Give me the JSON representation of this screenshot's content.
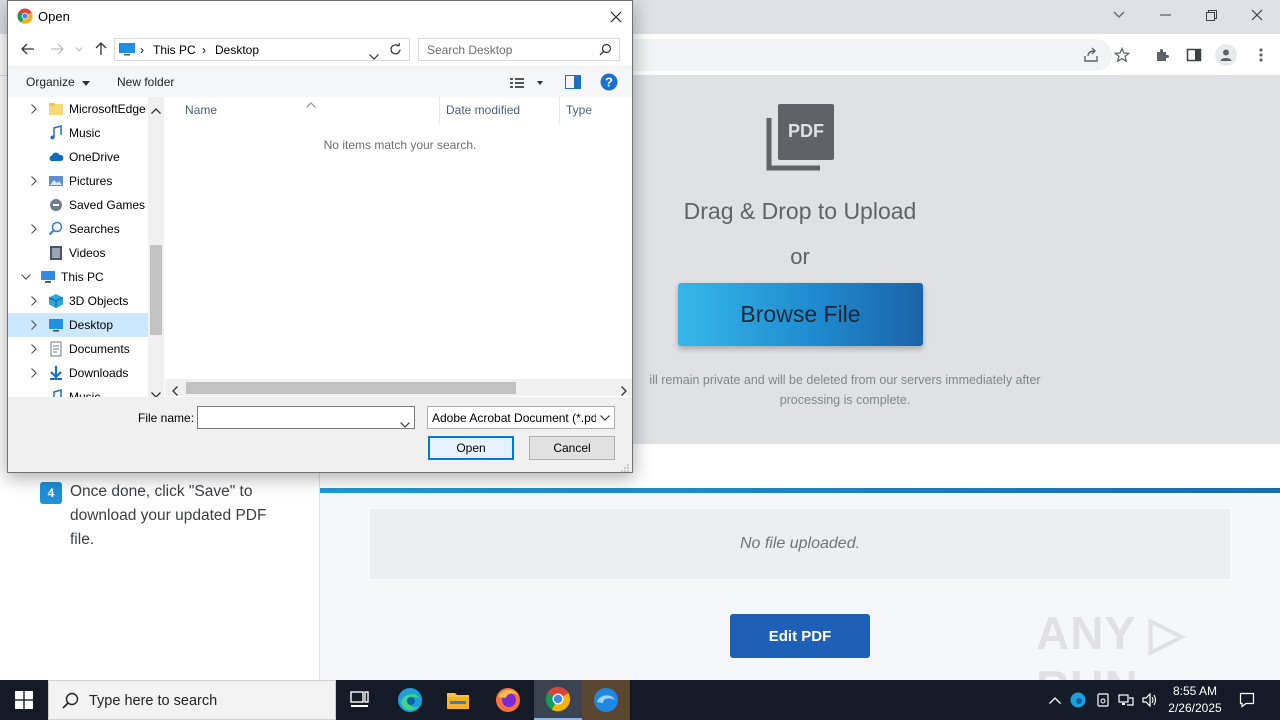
{
  "dialog": {
    "title": "Open",
    "path": [
      "This PC",
      "Desktop"
    ],
    "search_placeholder": "Search Desktop",
    "organize_label": "Organize",
    "new_folder_label": "New folder",
    "nav_items": [
      {
        "label": "MicrosoftEdge",
        "icon": "folder-icon",
        "expandable": true
      },
      {
        "label": "Music",
        "icon": "music-icon",
        "expandable": false
      },
      {
        "label": "OneDrive",
        "icon": "cloud-icon",
        "expandable": false
      },
      {
        "label": "Pictures",
        "icon": "pictures-icon",
        "expandable": true
      },
      {
        "label": "Saved Games",
        "icon": "saved-games-icon",
        "expandable": false
      },
      {
        "label": "Searches",
        "icon": "search-icon",
        "expandable": true
      },
      {
        "label": "Videos",
        "icon": "videos-icon",
        "expandable": false
      },
      {
        "label": "This PC",
        "icon": "computer-icon",
        "expandable": true
      },
      {
        "label": "3D Objects",
        "icon": "cube-icon",
        "expandable": true
      },
      {
        "label": "Desktop",
        "icon": "desktop-icon",
        "expandable": true,
        "selected": true
      },
      {
        "label": "Documents",
        "icon": "documents-icon",
        "expandable": true
      },
      {
        "label": "Downloads",
        "icon": "download-icon",
        "expandable": true
      },
      {
        "label": "Music",
        "icon": "music-icon",
        "expandable": false
      }
    ],
    "columns": [
      "Name",
      "Date modified",
      "Type"
    ],
    "empty_message": "No items match your search.",
    "file_name_label": "File name:",
    "file_name_value": "",
    "file_type": "Adobe Acrobat Document (*.pdf)",
    "open_label": "Open",
    "cancel_label": "Cancel"
  },
  "page": {
    "pdf_badge": "PDF",
    "drag_text": "Drag & Drop to Upload",
    "or_text": "or",
    "browse_label": "Browse File",
    "privacy_line1": "ill remain private and will be deleted from our servers immediately after",
    "privacy_line2": "processing is complete.",
    "step_number": "4",
    "step_text": "Once done, click \"Save\" to download your updated PDF file.",
    "no_file_text": "No file uploaded.",
    "edit_label": "Edit PDF",
    "watermark": "ANY RUN",
    "accent_color": "#1e5fb8"
  },
  "taskbar": {
    "search_placeholder": "Type here to search",
    "time": "8:55 AM",
    "date": "2/26/2025"
  }
}
